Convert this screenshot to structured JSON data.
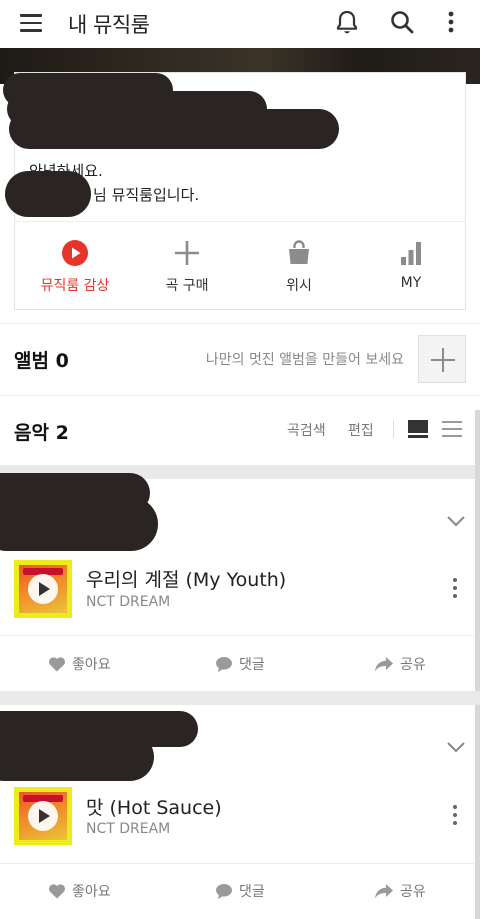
{
  "appbar": {
    "title": "내 뮤직룸",
    "icons": [
      "menu-icon",
      "bell-icon",
      "search-icon",
      "more-vertical-icon"
    ]
  },
  "profile": {
    "greeting_line1": "안녕하세요.",
    "greeting_line2": "님 뮤직룸입니다."
  },
  "actions": [
    {
      "label": "뮤직룸 감상",
      "icon": "play-circle-icon",
      "active": true
    },
    {
      "label": "곡 구매",
      "icon": "plus-icon",
      "active": false
    },
    {
      "label": "위시",
      "icon": "shopping-bag-icon",
      "active": false
    },
    {
      "label": "MY",
      "icon": "bar-chart-icon",
      "active": false
    }
  ],
  "album": {
    "title": "앨범 0",
    "hint": "나만의 멋진 앨범을 만들어 보세요"
  },
  "music": {
    "title": "음악 2",
    "search_label": "곡검색",
    "edit_label": "편집"
  },
  "tracks": [
    {
      "title": "우리의 계절 (My Youth)",
      "artist": "NCT DREAM",
      "like_label": "좋아요",
      "comment_label": "댓글",
      "share_label": "공유"
    },
    {
      "title": "맛 (Hot Sauce)",
      "artist": "NCT DREAM",
      "like_label": "좋아요",
      "comment_label": "댓글",
      "share_label": "공유"
    }
  ],
  "colors": {
    "accent": "#e8352b",
    "album_frame": "#ecec18",
    "redaction": "#2a2522"
  }
}
